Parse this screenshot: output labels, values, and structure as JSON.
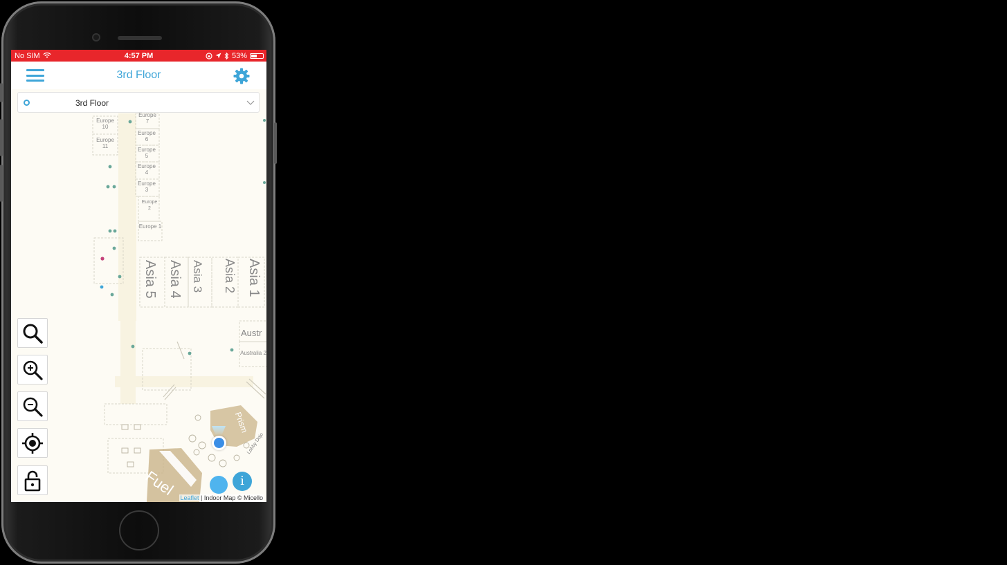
{
  "status_bar": {
    "carrier": "No SIM",
    "time": "4:57 PM",
    "battery_percent": "53%",
    "battery_level": 0.53
  },
  "nav": {
    "title": "3rd Floor"
  },
  "floor_selector": {
    "selected": "3rd Floor"
  },
  "map": {
    "rooms_europe": [
      "Europe 7",
      "Europe 10",
      "Europe 6",
      "Europe 11",
      "Europe 5",
      "Europe 4",
      "Europe 3",
      "Europe 2",
      "Europe 1"
    ],
    "rooms_asia": [
      "Asia 5",
      "Asia 4",
      "Asia 3",
      "Asia 2",
      "Asia 1"
    ],
    "australia": [
      "Austr",
      "Australia 2"
    ],
    "fuel_label": "Fuel",
    "prism_label": "Prism",
    "lobby_label": "Lobby Dojo"
  },
  "attribution": {
    "leaflet": "Leaflet",
    "rest": "| Indoor Map © Micello"
  },
  "info_label": "i",
  "colors": {
    "accent": "#3ea5d8",
    "status_red": "#e8262b",
    "map_bg": "#fdfbf4"
  }
}
